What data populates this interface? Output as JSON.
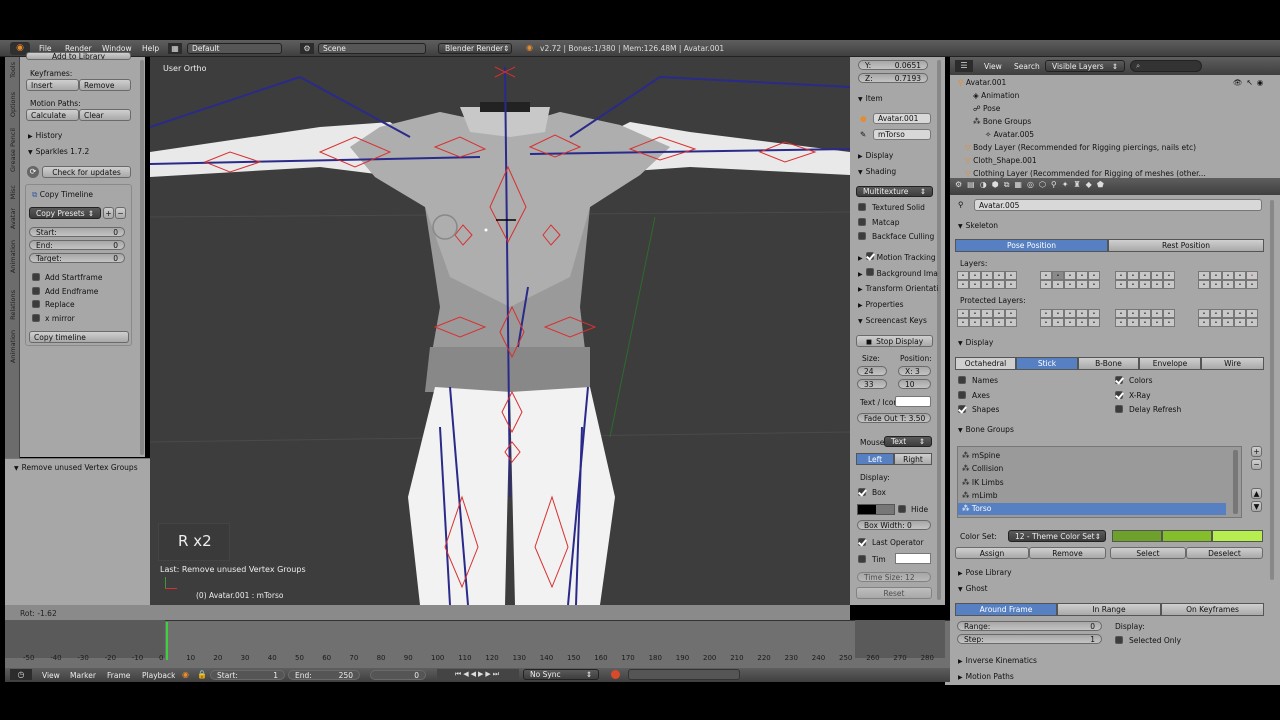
{
  "window": {
    "version": "v2.72 | Bones:1/380 | Mem:126.48M | Avatar.001"
  },
  "menu": {
    "items": [
      "File",
      "Render",
      "Window",
      "Help"
    ],
    "layout": "Default",
    "scene": "Scene",
    "engine": "Blender Render"
  },
  "left_tabs": [
    "Tools",
    "Options",
    "Grease Pencil",
    "Misc",
    "Avatar",
    "Animation",
    "Relations",
    "Animation"
  ],
  "tool": {
    "header_cut": "Add to Library",
    "keyframes_label": "Keyframes:",
    "insert": "Insert",
    "remove": "Remove",
    "motion_paths_label": "Motion Paths:",
    "calculate": "Calculate",
    "clear": "Clear",
    "history": "History",
    "sparkles": "Sparkles 1.7.2",
    "check_updates": "Check for updates",
    "copy_timeline": "Copy Timeline",
    "copy_presets": "Copy Presets",
    "start_label": "Start:",
    "start_val": "0",
    "end_label": "End:",
    "end_val": "0",
    "target_label": "Target:",
    "target_val": "0",
    "opts": [
      "Add Startframe",
      "Add Endframe",
      "Replace",
      "x mirror"
    ],
    "copy_timeline_btn": "Copy timeline",
    "remove_unused": "Remove unused Vertex Groups"
  },
  "viewport": {
    "view_label": "User Ortho",
    "overlay": "R x2",
    "last_op": "Last: Remove unused Vertex Groups",
    "object": "(0) Avatar.001 : mTorso",
    "rot": "Rot: -1.62"
  },
  "npanel": {
    "y_label": "Y:",
    "y_val": "0.0651",
    "z_label": "Z:",
    "z_val": "0.7193",
    "item": "Item",
    "obj": "Avatar.001",
    "bone": "mTorso",
    "display": "Display",
    "shading": "Shading",
    "multitexture": "Multitexture",
    "textured_solid": "Textured Solid",
    "matcap": "Matcap",
    "backface": "Backface Culling",
    "motion_tracking": "Motion Tracking",
    "background": "Background Images",
    "transform_orient": "Transform Orientations",
    "properties": "Properties",
    "screencast": "Screencast Keys",
    "stop_display": "Stop Display",
    "size_label": "Size:",
    "position_label": "Position:",
    "size1": "24",
    "size2": "33",
    "posx": "X: 3",
    "posy": "10",
    "text_icon": "Text / Icon",
    "fade_out": "Fade Out T: 3.50",
    "mouse_label": "Mouse:",
    "mouse_val": "Text",
    "left": "Left",
    "right": "Right",
    "display_label": "Display:",
    "box": "Box",
    "hide": "Hide",
    "box_width": "Box Width: 0",
    "last_operator": "Last Operator",
    "timer": "Tim",
    "time_size": "Time Size: 12",
    "reset": "Reset"
  },
  "outliner": {
    "view": "View",
    "search": "Search",
    "filter": "Visible Layers",
    "items": [
      "Avatar.001",
      "Animation",
      "Pose",
      "Bone Groups",
      "Avatar.005",
      "Body Layer (Recommended for Rigging piercings, nails etc)",
      "Cloth_Shape.001",
      "Clothing Layer (Recommended for Rigging of meshes (other..."
    ]
  },
  "props": {
    "armature": "Avatar.005",
    "skeleton": "Skeleton",
    "pose_position": "Pose Position",
    "rest_position": "Rest Position",
    "layers": "Layers:",
    "protected_layers": "Protected Layers:",
    "display": "Display",
    "display_tabs": [
      "Octahedral",
      "Stick",
      "B-Bone",
      "Envelope",
      "Wire"
    ],
    "names": "Names",
    "axes": "Axes",
    "shapes": "Shapes",
    "colors": "Colors",
    "xray": "X-Ray",
    "delay": "Delay Refresh",
    "bone_groups": "Bone Groups",
    "groups": [
      "mSpine",
      "Collision",
      "IK Limbs",
      "mLimb",
      "Torso"
    ],
    "color_set_label": "Color Set:",
    "color_set": "12 - Theme Color Set",
    "assign": "Assign",
    "remove": "Remove",
    "select": "Select",
    "deselect": "Deselect",
    "pose_library": "Pose Library",
    "ghost": "Ghost",
    "ghost_tabs": [
      "Around Frame",
      "In Range",
      "On Keyframes"
    ],
    "range_label": "Range:",
    "range_val": "0",
    "step_label": "Step:",
    "step_val": "1",
    "display_label2": "Display:",
    "selected_only": "Selected Only",
    "ik": "Inverse Kinematics",
    "motion_paths": "Motion Paths"
  },
  "timeline": {
    "ticks": [
      "-50",
      "-40",
      "-30",
      "-20",
      "-10",
      "0",
      "10",
      "20",
      "30",
      "40",
      "50",
      "60",
      "70",
      "80",
      "90",
      "100",
      "110",
      "120",
      "130",
      "140",
      "150",
      "160",
      "170",
      "180",
      "190",
      "200",
      "210",
      "220",
      "230",
      "240",
      "250",
      "260",
      "270",
      "280"
    ],
    "menu": [
      "View",
      "Marker",
      "Frame",
      "Playback"
    ],
    "start_label": "Start:",
    "start": "1",
    "end_label": "End:",
    "end": "250",
    "current": "0",
    "sync": "No Sync"
  },
  "colors": {
    "accent": "#5680c2",
    "viewport_bg": "#3d3d3d",
    "panel": "#a9a9a9",
    "dark": "#3a3a3a"
  }
}
